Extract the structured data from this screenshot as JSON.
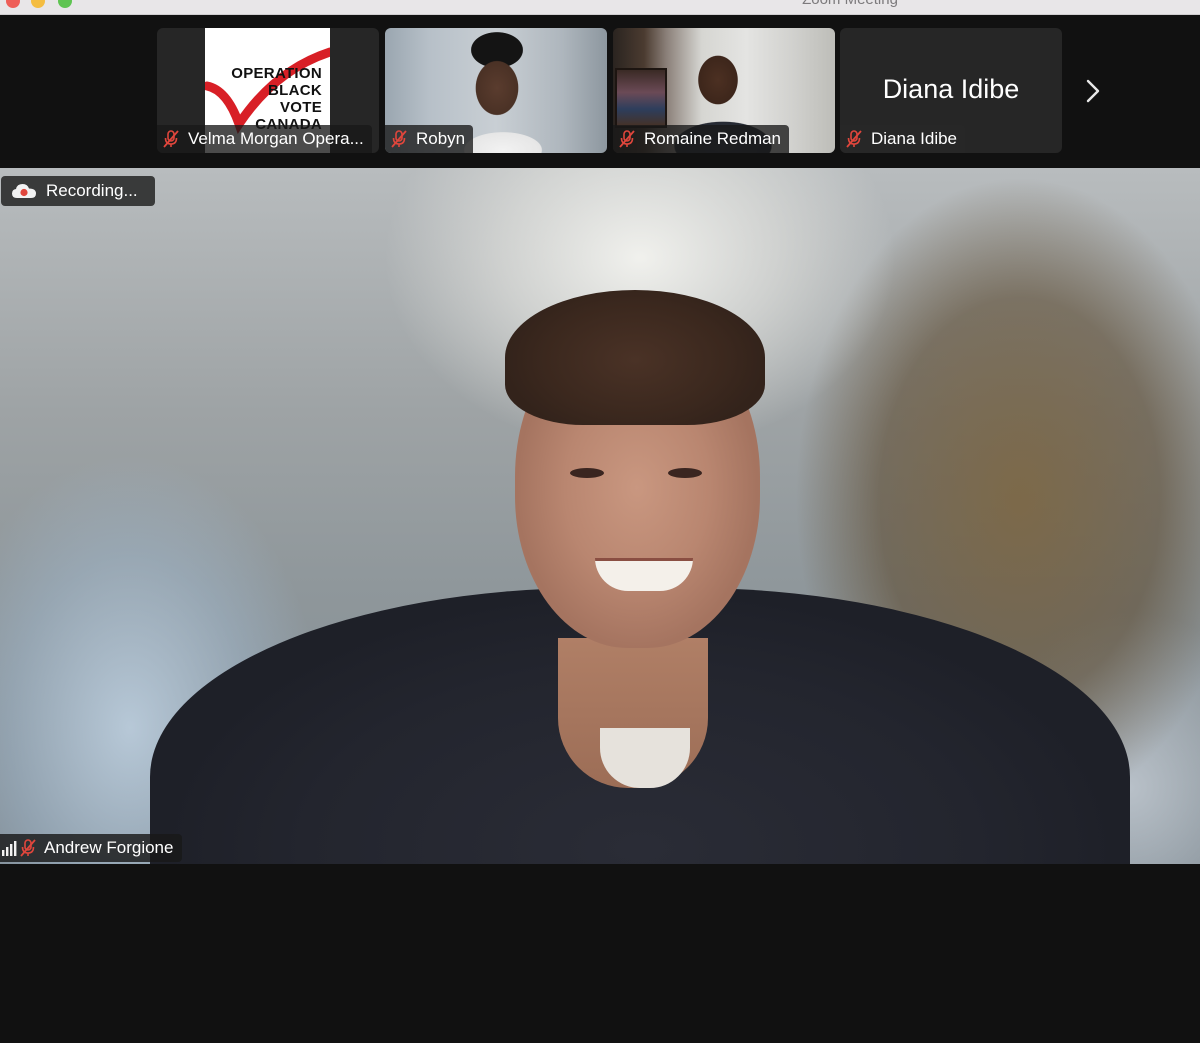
{
  "window": {
    "title": "Zoom Meeting"
  },
  "thumbnails": [
    {
      "name": "Velma Morgan Opera...",
      "muted": true
    },
    {
      "name": "Robyn",
      "muted": true
    },
    {
      "name": "Romaine Redman",
      "muted": true
    },
    {
      "name": "Diana Idibe",
      "muted": true,
      "display_name": "Diana Idibe"
    }
  ],
  "logo": {
    "lines": [
      "OPERATION",
      "BLACK",
      "VOTE",
      "CANADA"
    ]
  },
  "recording": {
    "label": "Recording..."
  },
  "active_speaker": {
    "name": "Andrew Forgione",
    "muted": true
  },
  "colors": {
    "background": "#111111",
    "tile": "#262626",
    "muted_mic": "#e0463c",
    "recording_dot": "#e0463c"
  },
  "icons": {
    "mic_off": "mic-off-icon",
    "next": "chevron-right-icon",
    "recording": "cloud-record-icon",
    "signal": "signal-bars-icon"
  }
}
